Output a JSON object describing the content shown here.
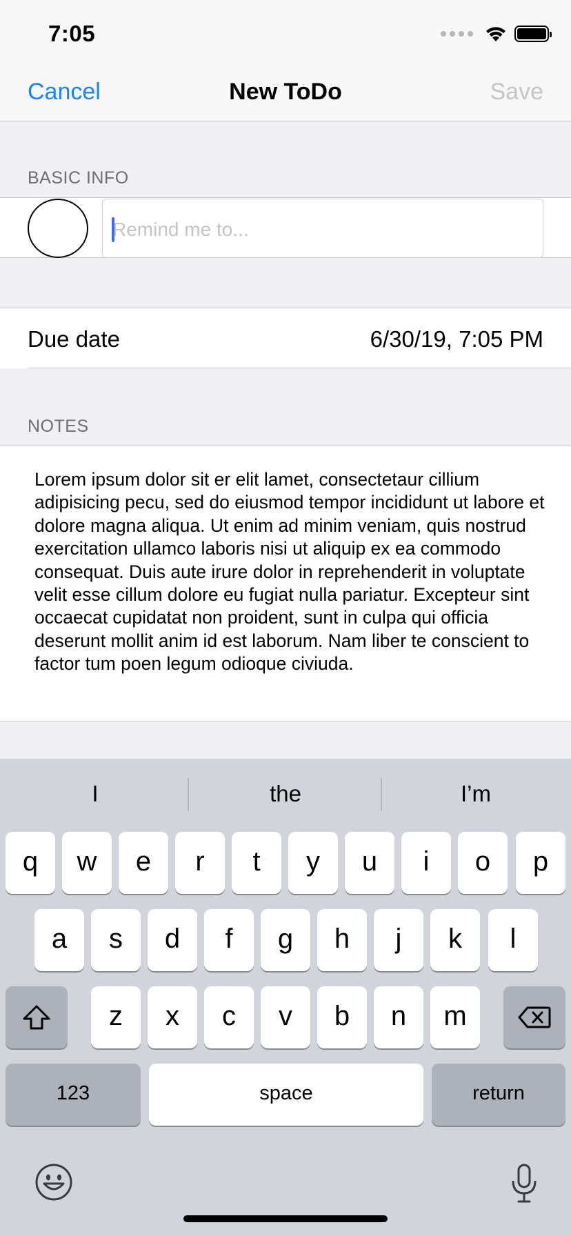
{
  "status_bar": {
    "time": "7:05"
  },
  "nav": {
    "cancel": "Cancel",
    "title": "New ToDo",
    "save": "Save"
  },
  "basic_info": {
    "header": "BASIC INFO",
    "placeholder": "Remind me to..."
  },
  "due": {
    "label": "Due date",
    "value": "6/30/19, 7:05 PM"
  },
  "notes": {
    "header": "NOTES",
    "text": "Lorem ipsum dolor sit er elit lamet, consectetaur cillium adipisicing pecu, sed do eiusmod tempor incididunt ut labore et dolore magna aliqua. Ut enim ad minim veniam, quis nostrud exercitation ullamco laboris nisi ut aliquip ex ea commodo consequat. Duis aute irure dolor in reprehenderit in voluptate velit esse cillum dolore eu fugiat nulla pariatur. Excepteur sint occaecat cupidatat non proident, sunt in culpa qui officia deserunt mollit anim id est laborum. Nam liber te conscient to factor tum poen legum odioque civiuda."
  },
  "keyboard": {
    "suggestions": [
      "I",
      "the",
      "I’m"
    ],
    "row1": [
      "q",
      "w",
      "e",
      "r",
      "t",
      "y",
      "u",
      "i",
      "o",
      "p"
    ],
    "row2": [
      "a",
      "s",
      "d",
      "f",
      "g",
      "h",
      "j",
      "k",
      "l"
    ],
    "row3": [
      "z",
      "x",
      "c",
      "v",
      "b",
      "n",
      "m"
    ],
    "numbers": "123",
    "space": "space",
    "return": "return",
    "icons": {
      "shift": "shift-icon",
      "delete": "delete-icon",
      "emoji": "emoji-icon",
      "mic": "microphone-icon"
    }
  },
  "colors": {
    "accent": "#1a82fb",
    "caret": "#3b6cf5",
    "disabled": "#c4c4c6"
  }
}
